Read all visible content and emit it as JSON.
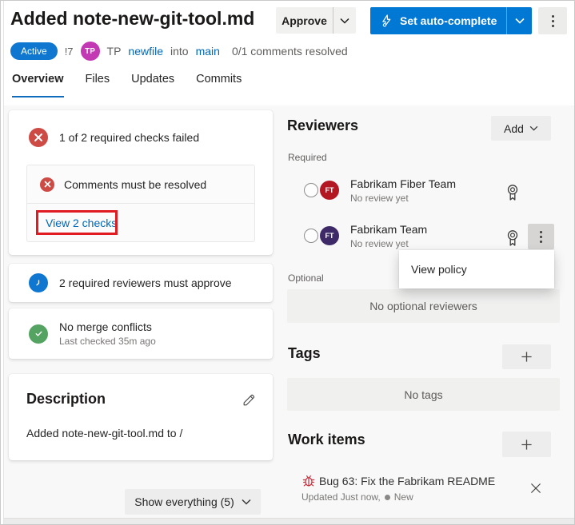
{
  "header": {
    "title": "Added note-new-git-tool.md",
    "approve_label": "Approve",
    "autocomplete_label": "Set auto-complete",
    "status_badge": "Active",
    "pr_id": "!7",
    "author_initials": "TP",
    "author_name": "TP",
    "source_branch": "newfile",
    "into_label": "into",
    "target_branch": "main",
    "comments_resolved": "0/1 comments resolved"
  },
  "tabs": [
    {
      "label": "Overview",
      "active": true
    },
    {
      "label": "Files",
      "active": false
    },
    {
      "label": "Updates",
      "active": false
    },
    {
      "label": "Commits",
      "active": false
    }
  ],
  "checks": {
    "failed_summary": "1 of 2 required checks failed",
    "comment_check": "Comments must be resolved",
    "view_checks_link": "View 2 checks",
    "reviewers_requirement": "2 required reviewers must approve"
  },
  "merge": {
    "title": "No merge conflicts",
    "subtitle": "Last checked 35m ago"
  },
  "description": {
    "title": "Description",
    "body": "Added note-new-git-tool.md to /"
  },
  "show_everything_label": "Show everything (5)",
  "reviewers": {
    "title": "Reviewers",
    "add_label": "Add",
    "required_label": "Required",
    "optional_label": "Optional",
    "no_optional_text": "No optional reviewers",
    "required_reviewers": [
      {
        "initials": "FT",
        "name": "Fabrikam Fiber Team",
        "status": "No review yet",
        "avatar_color": "#b21722"
      },
      {
        "initials": "FT",
        "name": "Fabrikam Team",
        "status": "No review yet",
        "avatar_color": "#3f2a68"
      }
    ],
    "context_menu_item": "View policy"
  },
  "tags": {
    "title": "Tags",
    "empty_text": "No tags"
  },
  "work_items": {
    "title": "Work items",
    "item": {
      "title": "Bug 63: Fix the Fabrikam README",
      "meta": "Updated Just now,",
      "state": "New"
    }
  },
  "colors": {
    "accent_blue": "#0078d4",
    "error_red": "#cd4a45",
    "success_green": "#55a362",
    "link_blue": "#0067b8",
    "annotation_red": "#e11b22",
    "author_avatar": "#c239b3",
    "active_tab_underline": "#0f6cbd"
  }
}
